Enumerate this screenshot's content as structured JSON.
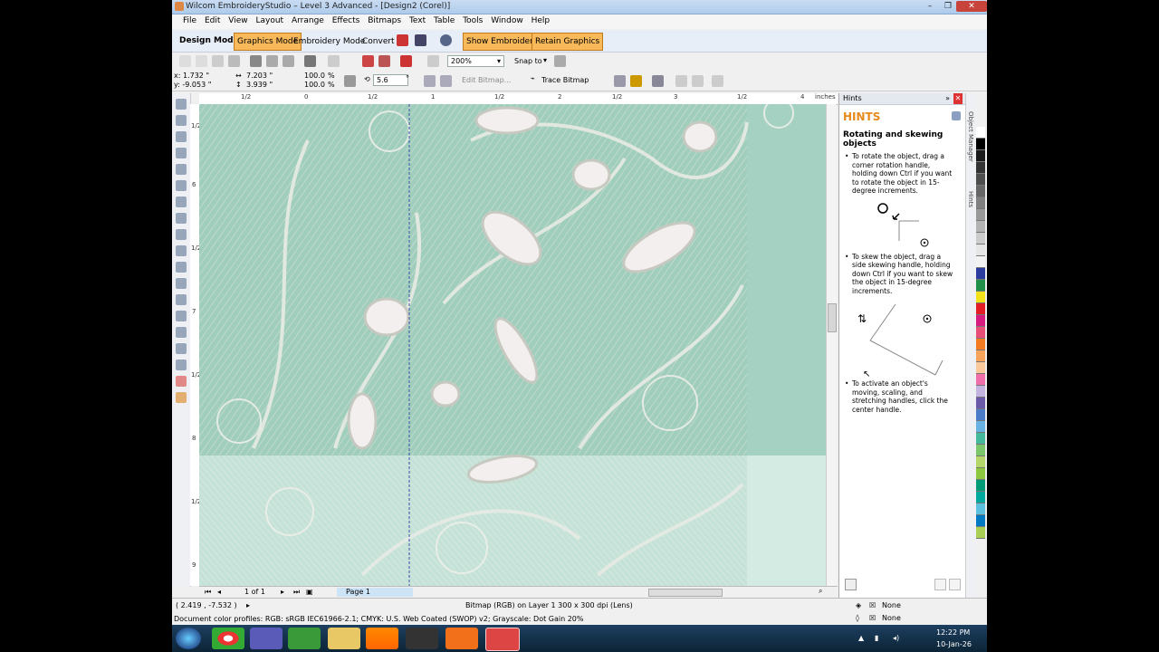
{
  "window": {
    "title": "Wilcom EmbroideryStudio – Level 3 Advanced - [Design2 (Corel)]"
  },
  "menu": [
    "File",
    "Edit",
    "View",
    "Layout",
    "Arrange",
    "Effects",
    "Bitmaps",
    "Text",
    "Table",
    "Tools",
    "Window",
    "Help"
  ],
  "modebar": {
    "label": "Design Mode:",
    "graphics_mode": "Graphics Mode",
    "embroidery_mode": "Embroidery Mode",
    "convert": "Convert",
    "show_embroidery": "Show Embroidery",
    "retain_graphics": "Retain Graphics"
  },
  "standard": {
    "zoom": "200%",
    "snap_to": "Snap to"
  },
  "props": {
    "x": "x: 1.732 \"",
    "y": "y: -9.053 \"",
    "w": "7.203 \"",
    "h": "3.939 \"",
    "sx": "100.0",
    "sy": "100.0",
    "pct": "%",
    "angle": "5.6",
    "deg": "°",
    "edit_bitmap": "Edit Bitmap...",
    "trace_bitmap": "Trace Bitmap"
  },
  "ruler": {
    "h_labels": [
      "1/2",
      "0",
      "1/2",
      "1",
      "1/2",
      "2",
      "1/2",
      "3",
      "1/2",
      "4",
      "1/2"
    ],
    "h_unit": "inches",
    "v_labels": [
      "1/2",
      "6",
      "1/2",
      "7",
      "1/2",
      "8",
      "1/2",
      "9"
    ],
    "v_unit": "inches"
  },
  "pagebar": {
    "page_count": "1 of 1",
    "page_tab": "Page 1"
  },
  "hints": {
    "panel_title": "Hints",
    "heading": "HINTS",
    "subheading": "Rotating and skewing objects",
    "p1": "To rotate the object, drag a corner rotation handle, holding down Ctrl if you want to rotate the object in 15-degree increments.",
    "p2": "To skew the object, drag a side skewing handle, holding down Ctrl if you want to skew the object in 15-degree increments.",
    "p3": "To activate an object's moving, scaling, and stretching handles, click the center handle."
  },
  "sidetabs": {
    "object_manager": "Object Manager",
    "hints": "Hints"
  },
  "status": {
    "coords": "( 2.419 , -7.532 )",
    "object_info": "Bitmap (RGB) on Layer 1 300 x 300 dpi  (Lens)",
    "color_profiles": "Document color profiles: RGB: sRGB IEC61966-2.1; CMYK: U.S. Web Coated (SWOP) v2; Grayscale: Dot Gain 20%",
    "fill": "None",
    "outline": "None"
  },
  "taskbar": {
    "time": "12:22 PM",
    "date": "10-Jan-26"
  },
  "palette": [
    "#ffffff",
    "#000000",
    "#1a1a1a",
    "#333333",
    "#4d4d4d",
    "#666666",
    "#808080",
    "#999999",
    "#b3b3b3",
    "#cccccc",
    "#e6e6e6",
    "#f2f2f2",
    "#2b3c9e",
    "#1f8f4a",
    "#f1e21a",
    "#e31e24",
    "#d81b7e",
    "#e94e77",
    "#f47b20",
    "#f7a35c",
    "#f9c89b",
    "#f06eaa",
    "#c4b5e0",
    "#6a5aa8",
    "#4b7cc8",
    "#68b2e3",
    "#45b99b",
    "#7bc86c",
    "#b5d66b",
    "#8dc63f",
    "#009b77",
    "#00a99d",
    "#5bc0de",
    "#007ac2",
    "#a9cf54"
  ],
  "colors": {
    "accent": "#f8b95a",
    "hint_heading": "#e8891b",
    "fabric": "#a8d2c1"
  }
}
